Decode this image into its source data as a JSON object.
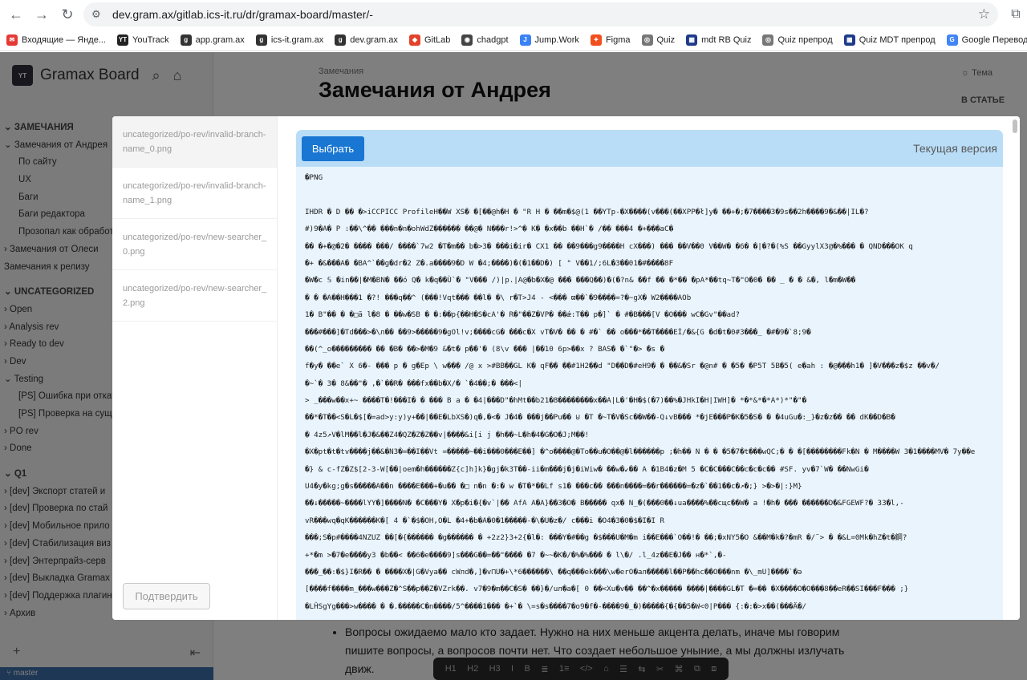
{
  "browser": {
    "url": "dev.gram.ax/gitlab.ics-it.ru/dr/gramax-board/master/-",
    "back_icon": "←",
    "forward_icon": "→",
    "reload_icon": "↻",
    "bookmarks": [
      {
        "label": "Входящие — Яндe...",
        "color": "#e53935",
        "glyph": "✉"
      },
      {
        "label": "YouTrack",
        "color": "#222",
        "glyph": "YT"
      },
      {
        "label": "app.gram.ax",
        "color": "#333",
        "glyph": "g"
      },
      {
        "label": "ics-it.gram.ax",
        "color": "#333",
        "glyph": "g"
      },
      {
        "label": "dev.gram.ax",
        "color": "#333",
        "glyph": "g"
      },
      {
        "label": "GitLab",
        "color": "#e2432a",
        "glyph": "◆"
      },
      {
        "label": "chadgpt",
        "color": "#444",
        "glyph": "◉"
      },
      {
        "label": "Jump.Work",
        "color": "#3b82f6",
        "glyph": "J"
      },
      {
        "label": "Figma",
        "color": "#f24e1e",
        "glyph": "✦"
      },
      {
        "label": "Quiz",
        "color": "#777",
        "glyph": "◎"
      },
      {
        "label": "mdt RB Quiz",
        "color": "#1e3a8a",
        "glyph": "▦"
      },
      {
        "label": "Quiz препрод",
        "color": "#777",
        "glyph": "◎"
      },
      {
        "label": "Quiz MDT препрод",
        "color": "#1e3a8a",
        "glyph": "▦"
      },
      {
        "label": "Google Перевод",
        "color": "#4285f4",
        "glyph": "G"
      }
    ]
  },
  "app": {
    "logo_badge": "YT",
    "title": "Gramax Board",
    "sidebar": [
      {
        "label": "ЗАМЕЧАНИЯ",
        "indent": 0,
        "prefix": "⌄",
        "header": true
      },
      {
        "label": "Замечания от Андрея",
        "indent": 0,
        "prefix": "⌄"
      },
      {
        "label": "По сайту",
        "indent": 1,
        "prefix": ""
      },
      {
        "label": "UX",
        "indent": 1,
        "prefix": ""
      },
      {
        "label": "Баги",
        "indent": 1,
        "prefix": ""
      },
      {
        "label": "Баги редактора",
        "indent": 1,
        "prefix": ""
      },
      {
        "label": "Прозопал как обработ",
        "indent": 1,
        "prefix": ""
      },
      {
        "label": "Замечания от Олеси",
        "indent": 0,
        "prefix": "›"
      },
      {
        "label": "Замечания к релизу",
        "indent": 0,
        "prefix": ""
      },
      {
        "label": "UNCATEGORIZED",
        "indent": 0,
        "prefix": "⌄",
        "header": true,
        "gap": true
      },
      {
        "label": "Open",
        "indent": 0,
        "prefix": "›"
      },
      {
        "label": "Analysis rev",
        "indent": 0,
        "prefix": "›"
      },
      {
        "label": "Ready to dev",
        "indent": 0,
        "prefix": "›"
      },
      {
        "label": "Dev",
        "indent": 0,
        "prefix": "›"
      },
      {
        "label": "Testing",
        "indent": 0,
        "prefix": "⌄"
      },
      {
        "label": "[PS] Ошибка при откат",
        "indent": 1,
        "prefix": ""
      },
      {
        "label": "[PS] Проверка на сущ",
        "indent": 1,
        "prefix": ""
      },
      {
        "label": "PO rev",
        "indent": 0,
        "prefix": "›"
      },
      {
        "label": "Done",
        "indent": 0,
        "prefix": "›"
      },
      {
        "label": "Q1",
        "indent": 0,
        "prefix": "⌄",
        "header": true,
        "gap": true
      },
      {
        "label": "[dev] Экспорт статей и ",
        "indent": 0,
        "prefix": "›"
      },
      {
        "label": "[dev] Проверка по стай",
        "indent": 0,
        "prefix": "›"
      },
      {
        "label": "[dev] Мобильное прило",
        "indent": 0,
        "prefix": "›"
      },
      {
        "label": "[dev] Стабилизация виз",
        "indent": 0,
        "prefix": "›"
      },
      {
        "label": "[dev] Энтерпрайз-серв",
        "indent": 0,
        "prefix": "›"
      },
      {
        "label": "[dev] Выкладка Gramax",
        "indent": 0,
        "prefix": "›"
      },
      {
        "label": "[dev] Поддержка плагин",
        "indent": 0,
        "prefix": "›"
      },
      {
        "label": "Архив",
        "indent": 0,
        "prefix": "›"
      }
    ],
    "branch": "master",
    "breadcrumb": "Замечания",
    "page_title": "Замечания от Андрея",
    "theme_label": "Тема",
    "toc_label": "В СТАТЬЕ",
    "body_text": "Вопросы ожидаемо мало кто задает. Нужно на них меньше акцента делать, иначе мы говорим пишите вопросы, а вопросов почти нет. Что создает небольшое уныние, а мы должны излучать движ.",
    "toolbar_items": [
      "H1",
      "H2",
      "H3",
      "I",
      "B",
      "≣",
      "1≡",
      "</>",
      "⌂",
      "☰",
      "⇆",
      "✂",
      "⌘",
      "⧉",
      "⧈"
    ]
  },
  "modal": {
    "files": [
      {
        "path": "uncategorized/po-rev/invalid-branch-name_0.png",
        "active": true
      },
      {
        "path": "uncategorized/po-rev/invalid-branch-name_1.png",
        "active": false
      },
      {
        "path": "uncategorized/po-rev/new-searcher_0.png",
        "active": false
      },
      {
        "path": "uncategorized/po-rev/new-searcher_2.png",
        "active": false
      }
    ],
    "confirm_label": "Подтвердить",
    "select_label": "Выбрать",
    "version_label": "Текущая версия",
    "binary_lines": [
      "�PNG",
      "",
      "IHDR � D �� �>iCCPICC ProfileH��W XS� �[��@h�H    �       \"R H     � ��m�$@(1 ��YTp-�X����(v���(��XPP�ł]y� ��+�;�7����3�9s��2h����9�&��|IL�?",
      "#)9�A� P :��\\^��   ���n�n�ohWdZ������ ��@� N���r!>^� K�  �x��b ��H`� /�� ���4 �+���aC�",
      "�� �+�@�2�  ���� ���/  ����`7w2 �T�m�� b�>3� ���i�ir� CX1 �� ��9���g9����H cX���)     ��� ��V��0 V��W�          �6� �|�?�(%S ��GyylX3@�%��� � QND���OK  q",
      "�+ �&���A� �BA^`��g�dr�2 Z�.a����9�D W �4;����)�(�1��D�) [ \" V��1/;6L�3��01�#����8F",
      "�W�c 𝕊 �in��|�M�BN� ��ó Q� k�q��Ù`� \"V��� /)|p.|A@�b�X�@ ��� ���Q��)�(�?n&        ��f �� �*��       �pA*��tq~T�\"O�0�  �� _ �   �   &�, l�m�W��",
      "�  � �A��H���1  �?! ���q��^ (���!Vqt��� ��l� �\\  r�T>J4 - <��� ϖ��`�9����=?�~gX�     W2����AOb",
      "1� B\"�� � �□ã l�8 � ��w�SB � �:��p{��H�S�cA'� R�\"��Z�VP� ��ǽ:T�� p�]`  � #�B���[V �O��� wC�Gv\"��ad?",
      "���#���]�Td���>�\\л�� ��9>�����9�gOl!v;����cG� ���c�X vT�V� �� � #�` �� o���*��T����Eİ/�&{G �d�t�0#3���_  �#�9�`8;9�",
      "��(^_o��������� ��   �B� ��>�M�9 &�t� p��'� (8\\v  ��� |��10 6p>��x ? BAS� �`\"�> �s    �",
      "f�y� ��e` X 6�- ��� p � g�Ep \\ w��� /@ x >#BB��GL K� qF�� ��#1H2��d \"D��D�#eH9� �  ��&�Sr �@n# � �5�   �P5T 5B�5( e�ah : �@���h1� ]�V���z�$z ��v�/",
      "�~`� 3� 8&��\"� ,�`��R� ���fx��b�X/� `�4��;� ���<|",
      "> _���w��x+~ ����T�!���I� � ��� B a � �4|���D\"�hMt��b21�8��������x��A|L�'�H�$(�7)��%�JHkI�H|IWH]�  *�*&*�*A*)*\"�\"�",
      "��*�T��<S�L�$[�=ad>y:y)y+��|��E�LbXS�)q�,�<� J�4�  ���j��Pu�� ⊍ �T �~T�V�Sc��W��-Q↓vB��� *�jE���P�K�5�S� � �4uGu�:_}�z�z�� �� dK��D�B�",
      "� 4z5↗V�lM��l�J�&��Z4�QZ�Z�Z��v|����&i[i j  �h��~L�h�4�G�O�J;M��!",
      "�X�pt�t�tv����j��&�N3�=��I��Vt =�����~��i���0���E��]  �^o����@�To��u�O��@�l������p ;�h��  N � � �5�7�t���wQC;� � �[��������Fk�N � M����W  3�1����MV� 7y��e",
      "�} & c-fZ�Z$[2-3-W[��|oem�h������Z{c]h]k}�gj�k3T��-ii�m���j�j�iWiw� ��w�↙�� A �1B4�z�M 5 �C�C���C��c�c�c�� #SF. yv�7`W� ��NwGi�",
      "U4�y�kg;g�s�����A��n ����E���+�u�� �□ n�n �:� w �T�*��Lf s1� ���c�� ���n����=��r������=�z�`��1��c�↗�;} >�>�|:}M}",
      "��↓�����~����lYY�]����N� �C���Y�  X�p�i�{�v`|�� AfA A�A}��3�O� B�����  qx� N_�(���0��↓ua����%��cщc��W� a !�h� ��� ������D�&FGEWF?�  33�l,-",
      "vR���wq�qK������K�[ 4 �`�$�OH,O�L �4+�b�A�0�1�����-�\\�U�z�/ c���i �O4�3�0�$�I�I R",
      "���;S�p#����4NZUZ ��[�{������ �g������ � +2z2}3+2{�l�: ���Y�#��g �$���U�M�m i��E���`O��!� ��;�xNY5�O &��M�k�?�mR �/˜> �  �&L=0Mk�hZ�t�鋼?",
      "+*�m >�7�e����y3 �b��< ��6�e����9]s���G��=��\"���� �7   �~~�K�/�%�%��� � l\\�/ .l_4z��E�J�� н�*`,�-",
      "���_��:�$}I�R�� � ����X�|G�Vya�� cWлd�,]�v⊓U�+\\*6������\\ ��q���ek���\\w�erO�aл�����l��P��hc��O���nm �\\_mU]����`�ǝ",
      "[����f����m_���w���Z�^S��p��Z�VZrk��. v7�9�m��C�S� ��}�/uл�a�[ 0 ��<Xu�v�� ��^�x����� ����|����GL�T �=�� �X����O�O���8��eR��SI���F��� ;}",
      "�LĤSgYg���>w���� � �.�����C�n����/5^����1��� �+`� \\=s�s����7�o9�f�-����9�_�)�����{�{��5�W<0|P��� {:�:�>x��(���Ä�/"
    ]
  }
}
